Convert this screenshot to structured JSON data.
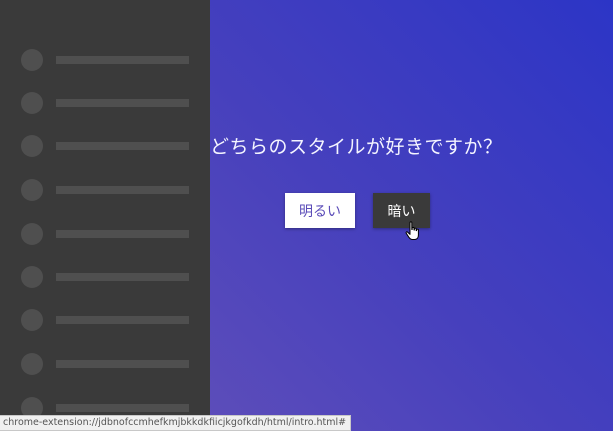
{
  "main": {
    "question": "どちらのスタイルが好きですか？",
    "buttons": {
      "light_label": "明るい",
      "dark_label": "暗い"
    }
  },
  "sidebar": {
    "placeholder_rows": 9
  },
  "status_bar": {
    "url": "chrome-extension://jdbnofccmhefkmjbkkdkfiicjkgofkdh/html/intro.html#"
  },
  "colors": {
    "gradient_start": "#2c35c6",
    "gradient_end": "#6a55b8",
    "sidebar": "#3a3a3a",
    "placeholder": "#4f4f4f",
    "light_button_text": "#5a4bb8"
  }
}
